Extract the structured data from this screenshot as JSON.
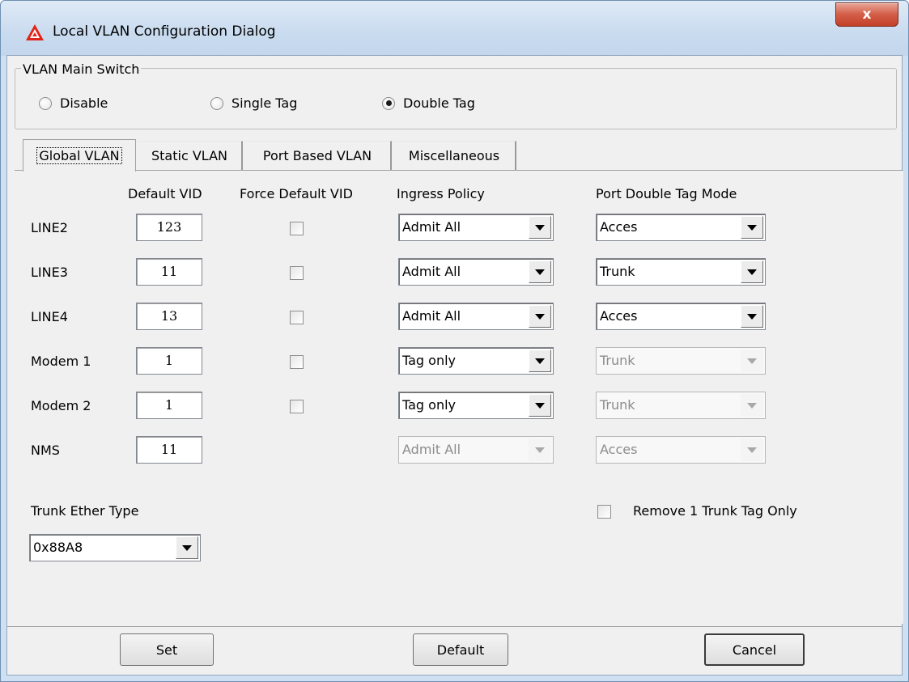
{
  "window": {
    "title": "Local VLAN Configuration Dialog",
    "close_label": "x"
  },
  "vlan_main_switch": {
    "legend": "VLAN Main Switch",
    "options": [
      {
        "label": "Disable",
        "selected": false
      },
      {
        "label": "Single Tag",
        "selected": false
      },
      {
        "label": "Double Tag",
        "selected": true
      }
    ]
  },
  "tabs": [
    {
      "label": "Global VLAN",
      "active": true
    },
    {
      "label": "Static VLAN",
      "active": false
    },
    {
      "label": "Port Based VLAN",
      "active": false
    },
    {
      "label": "Miscellaneous",
      "active": false
    }
  ],
  "table": {
    "headers": {
      "default_vid": "Default VID",
      "force_default_vid": "Force Default VID",
      "ingress_policy": "Ingress Policy",
      "port_double_tag_mode": "Port Double Tag Mode"
    },
    "rows": [
      {
        "label": "LINE2",
        "vid": "123",
        "force": false,
        "ingress": "Admit All",
        "ingress_enabled": true,
        "mode": "Acces",
        "mode_enabled": true
      },
      {
        "label": "LINE3",
        "vid": "11",
        "force": false,
        "ingress": "Admit All",
        "ingress_enabled": true,
        "mode": "Trunk",
        "mode_enabled": true
      },
      {
        "label": "LINE4",
        "vid": "13",
        "force": false,
        "ingress": "Admit All",
        "ingress_enabled": true,
        "mode": "Acces",
        "mode_enabled": true
      },
      {
        "label": "Modem 1",
        "vid": "1",
        "force": false,
        "ingress": "Tag only",
        "ingress_enabled": true,
        "mode": "Trunk",
        "mode_enabled": false
      },
      {
        "label": "Modem 2",
        "vid": "1",
        "force": false,
        "ingress": "Tag only",
        "ingress_enabled": true,
        "mode": "Trunk",
        "mode_enabled": false
      },
      {
        "label": "NMS",
        "vid": "11",
        "force": null,
        "ingress": "Admit All",
        "ingress_enabled": false,
        "mode": "Acces",
        "mode_enabled": false
      }
    ]
  },
  "trunk_ether_type": {
    "label": "Trunk Ether Type",
    "value": "0x88A8"
  },
  "remove_trunk_tag": {
    "label": "Remove 1 Trunk Tag Only",
    "checked": false
  },
  "buttons": {
    "set": "Set",
    "default": "Default",
    "cancel": "Cancel"
  },
  "colors": {
    "frame": "#cfe0f2",
    "client": "#f0f0f0",
    "close_button": "#c3402a",
    "app_icon": "#e2231a"
  }
}
